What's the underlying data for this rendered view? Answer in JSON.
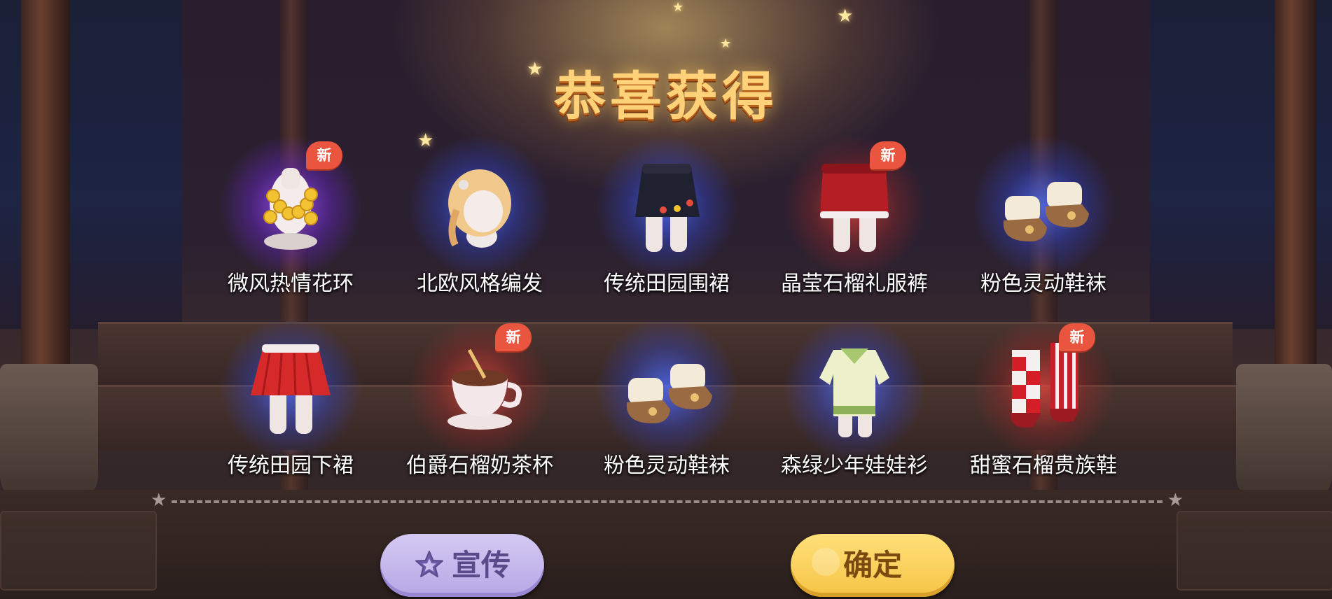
{
  "title": "恭喜获得",
  "new_badge": "新",
  "items_row1": [
    {
      "name": "微风热情花环",
      "is_new": true,
      "glow": "purple",
      "icon": "flower-lei-necklace-icon"
    },
    {
      "name": "北欧风格编发",
      "is_new": false,
      "glow": "blue",
      "icon": "braided-hair-icon"
    },
    {
      "name": "传统田园围裙",
      "is_new": false,
      "glow": "blue",
      "icon": "apron-skirt-icon"
    },
    {
      "name": "晶莹石榴礼服裤",
      "is_new": true,
      "glow": "red",
      "icon": "red-shorts-icon"
    },
    {
      "name": "粉色灵动鞋袜",
      "is_new": false,
      "glow": "blue",
      "icon": "brown-shoes-icon"
    }
  ],
  "items_row2": [
    {
      "name": "传统田园下裙",
      "is_new": false,
      "glow": "blue",
      "icon": "red-pleated-skirt-icon"
    },
    {
      "name": "伯爵石榴奶茶杯",
      "is_new": true,
      "glow": "red",
      "icon": "teacup-icon"
    },
    {
      "name": "粉色灵动鞋袜",
      "is_new": false,
      "glow": "blue",
      "icon": "brown-shoes-icon"
    },
    {
      "name": "森绿少年娃娃衫",
      "is_new": false,
      "glow": "blue",
      "icon": "green-shirt-icon"
    },
    {
      "name": "甜蜜石榴贵族鞋",
      "is_new": true,
      "glow": "red",
      "icon": "checkered-socks-shoes-icon"
    }
  ],
  "buttons": {
    "promo": "宣传",
    "confirm": "确定"
  },
  "colors": {
    "title": "#ffd27a",
    "badge": "#e9553e",
    "promo_button": "#c6b8ee",
    "confirm_button": "#f6c445",
    "glow_purple": "#a050ff",
    "glow_blue": "#506eff",
    "glow_red": "#e6463c"
  }
}
